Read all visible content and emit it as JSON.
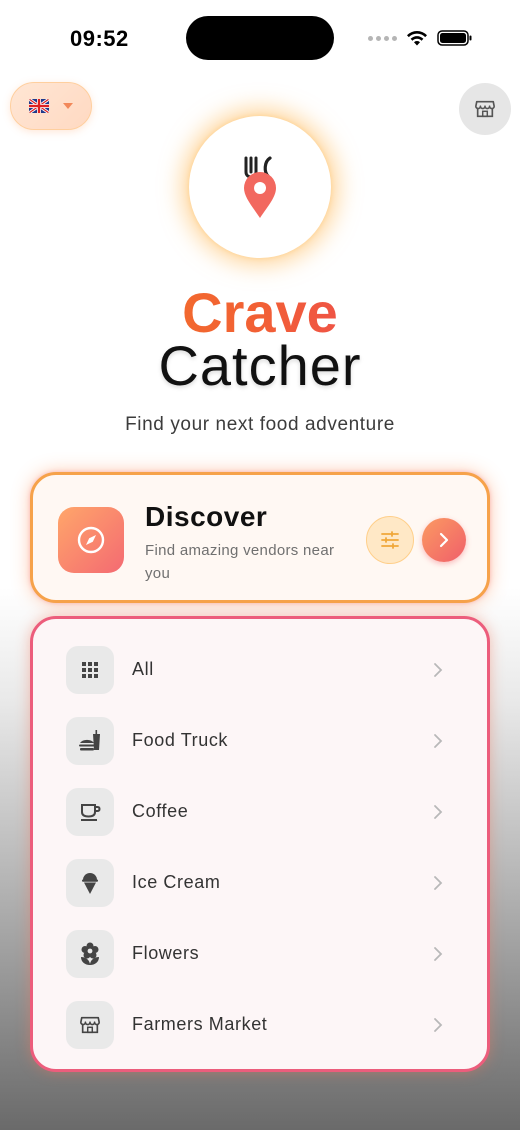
{
  "status_bar": {
    "time": "09:52",
    "icons": [
      "cellular-dots-icon",
      "wifi-icon",
      "battery-icon"
    ]
  },
  "header": {
    "language_flag": "uk-flag-icon",
    "store_icon": "storefront-icon"
  },
  "brand": {
    "logo_icon": "fork-knife-pin-icon",
    "title_top": "Crave",
    "title_bottom": "Catcher",
    "tagline": "Find your next food adventure"
  },
  "discover": {
    "title": "Discover",
    "subtitle": "Find amazing vendors near you",
    "icon": "compass-icon",
    "filter_icon": "sliders-icon",
    "go_icon": "chevron-right-icon"
  },
  "categories": [
    {
      "label": "All",
      "icon": "grid-icon"
    },
    {
      "label": "Food Truck",
      "icon": "food-truck-icon"
    },
    {
      "label": "Coffee",
      "icon": "coffee-icon"
    },
    {
      "label": "Ice Cream",
      "icon": "ice-cream-icon"
    },
    {
      "label": "Flowers",
      "icon": "flower-icon"
    },
    {
      "label": "Farmers Market",
      "icon": "storefront-icon"
    }
  ],
  "colors": {
    "accent_orange": "#f47c1f",
    "accent_pink": "#e8386a",
    "discover_border": "#f6a24a",
    "category_border": "#ec5d7c"
  }
}
